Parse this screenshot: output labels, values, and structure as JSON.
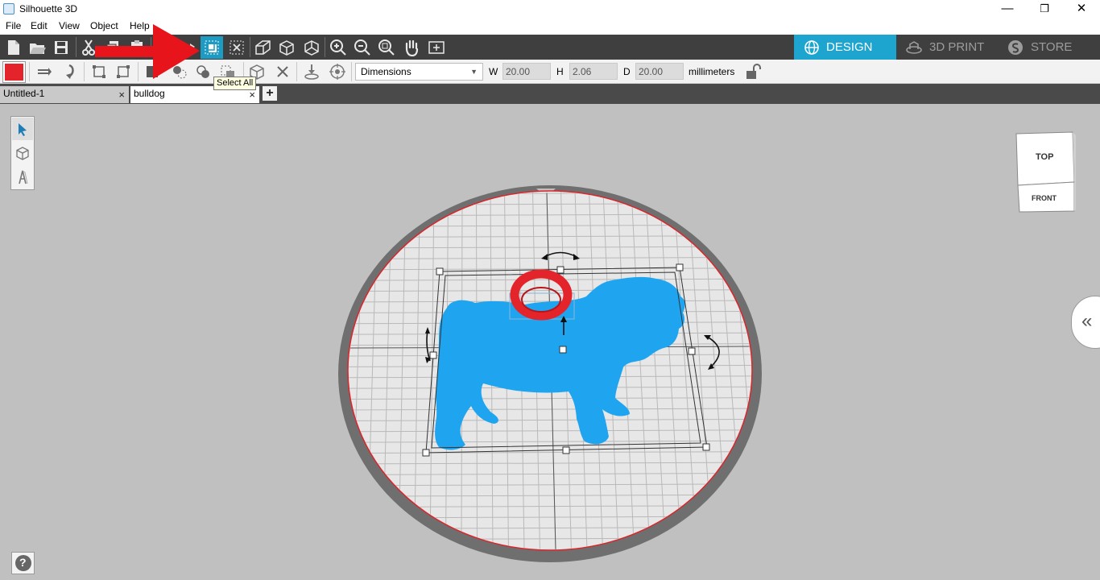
{
  "window": {
    "title": "Silhouette 3D",
    "controls": {
      "minimize": "—",
      "restore": "❐",
      "close": "✕"
    }
  },
  "menu": [
    "File",
    "Edit",
    "View",
    "Object",
    "Help"
  ],
  "mode_tabs": [
    {
      "label": "DESIGN",
      "icon": "globe-icon",
      "active": true
    },
    {
      "label": "3D PRINT",
      "icon": "printer-icon",
      "active": false
    },
    {
      "label": "STORE",
      "icon": "store-icon",
      "active": false
    }
  ],
  "toolbar": {
    "icons": [
      "new-file-icon",
      "open-folder-icon",
      "save-icon",
      "cut-icon",
      "copy-icon",
      "paste-icon",
      "undo-icon",
      "redo-icon",
      "select-all-icon",
      "deselect-icon",
      "extrude-icon",
      "box-icon",
      "cube-icon",
      "zoom-in-icon",
      "zoom-out-icon",
      "zoom-fit-icon",
      "pan-hand-icon",
      "fit-view-icon"
    ],
    "tooltip": "Select All"
  },
  "properties": {
    "fill_color": "#e3242b",
    "dimension_mode": "Dimensions",
    "width_label": "W",
    "width_value": "20.00",
    "height_label": "H",
    "height_value": "2.06",
    "depth_label": "D",
    "depth_value": "20.00",
    "units": "millimeters",
    "lock": "unlocked"
  },
  "tabs": [
    {
      "label": "Untitled-1",
      "active": false
    },
    {
      "label": "bulldog",
      "active": true
    }
  ],
  "tab_close": "×",
  "tab_add": "+",
  "view_cube": {
    "top": "TOP",
    "front": "FRONT"
  },
  "side_tools": [
    "pointer-icon",
    "cube-view-icon",
    "text-3d-icon"
  ],
  "help": "?",
  "collapse": "«",
  "colors": {
    "accent": "#1ea5cf",
    "model": "#1fa5f0",
    "ring": "#e3242b",
    "annotation_arrow": "#e8141c"
  }
}
